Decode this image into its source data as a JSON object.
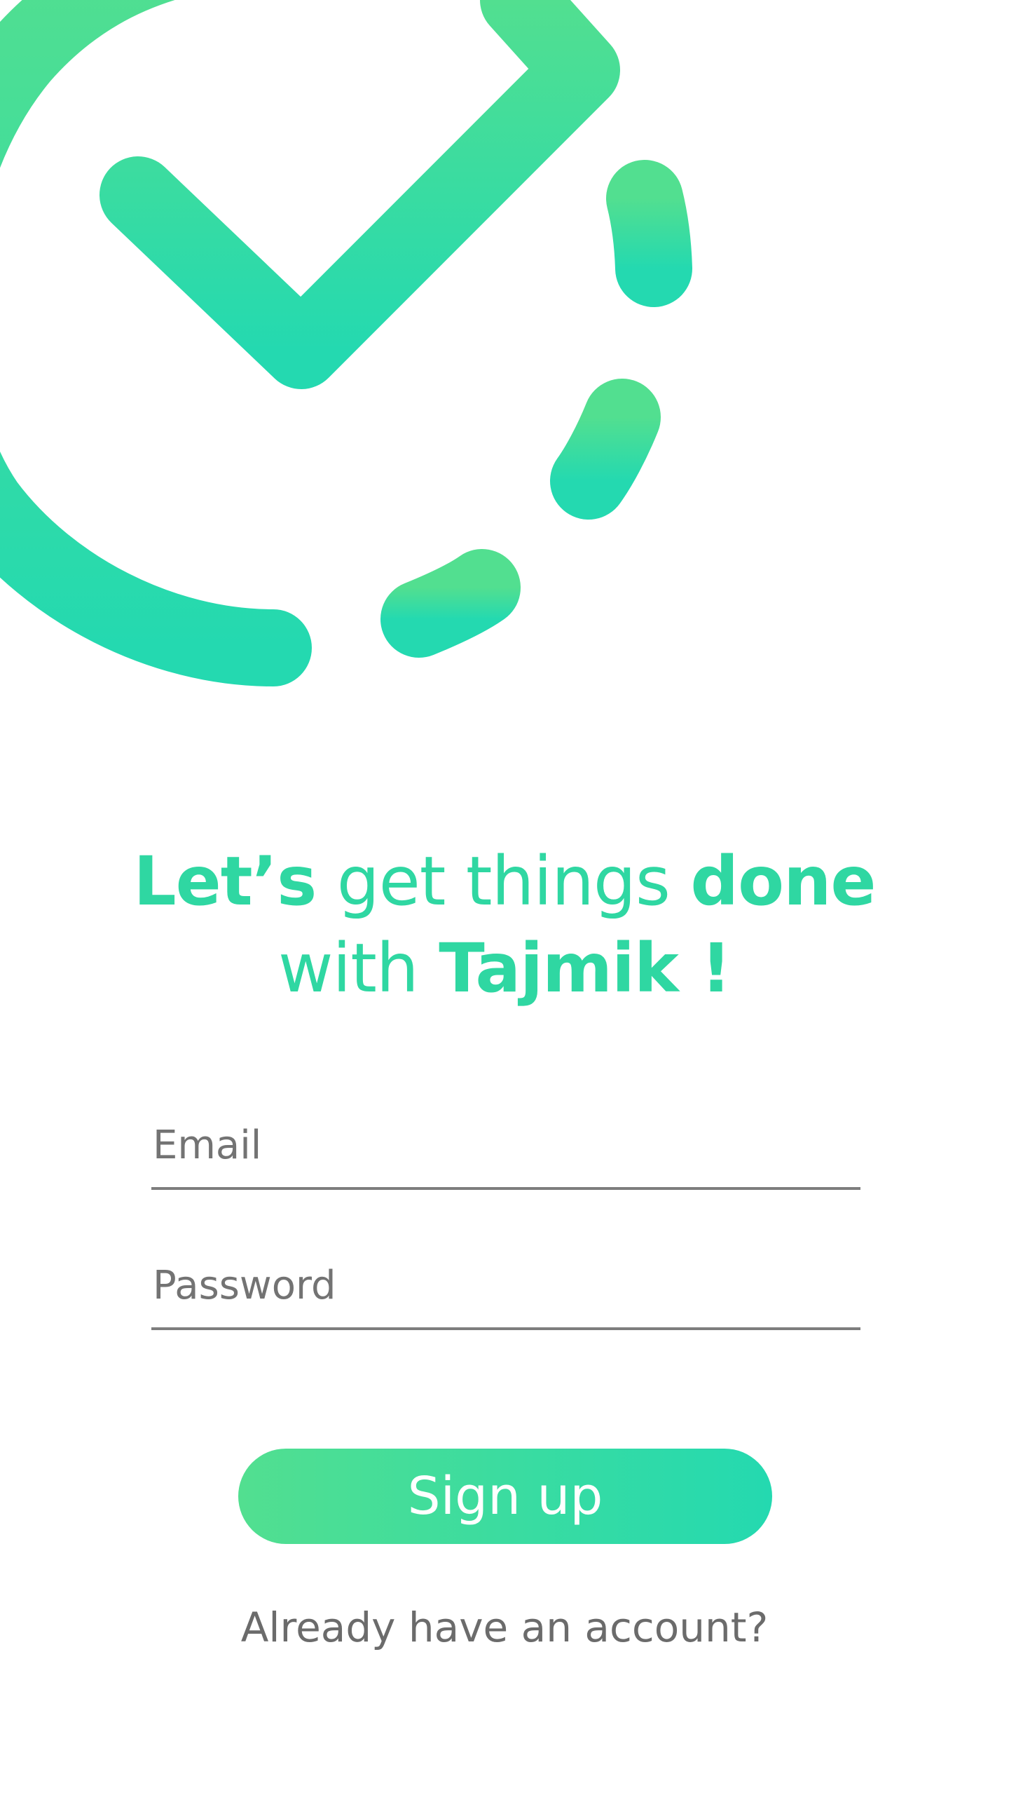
{
  "theme": {
    "accent": "#2fd7a2",
    "gradient_start": "#52df90",
    "gradient_end": "#24d9b0",
    "underline": "#7d7d7d",
    "muted_text": "#6b6b6b"
  },
  "logo": {
    "icon": "dashed-circle-checkmark-icon"
  },
  "headline": {
    "part1": "Let’s",
    "part2": " get things ",
    "part3": "done",
    "part4": "with ",
    "part5": "Tajmik !"
  },
  "form": {
    "email_placeholder": "Email",
    "password_placeholder": "Password"
  },
  "actions": {
    "signup_label": "Sign up",
    "login_link": "Already have an account?"
  }
}
